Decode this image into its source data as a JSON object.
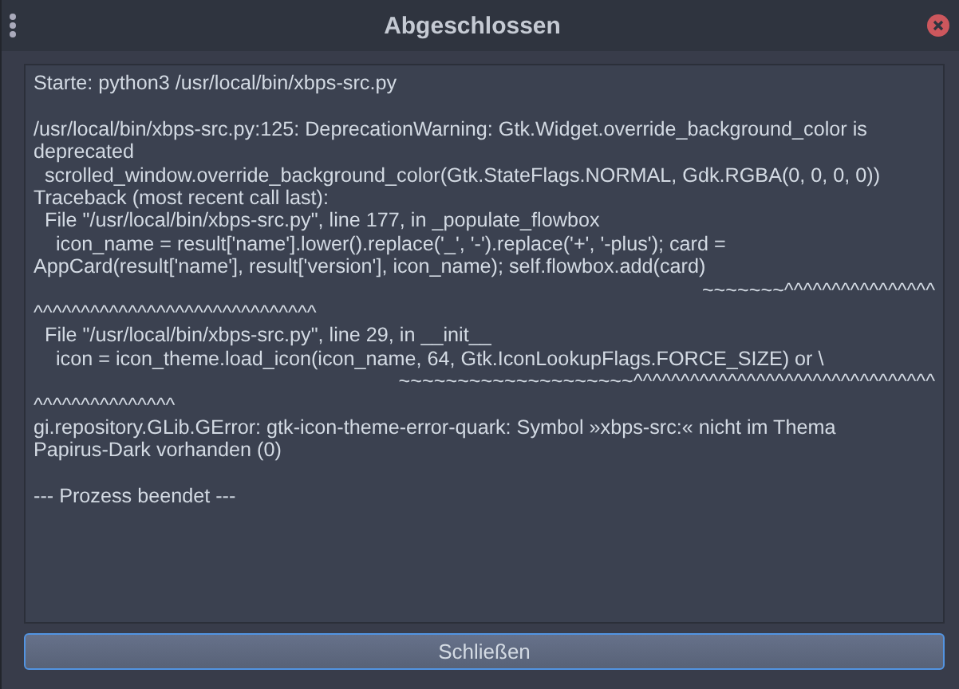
{
  "window": {
    "title": "Abgeschlossen"
  },
  "output": {
    "lines": [
      {
        "kind": "text",
        "text": "Starte: python3 /usr/local/bin/xbps-src.py"
      },
      {
        "kind": "blank"
      },
      {
        "kind": "text",
        "text": "/usr/local/bin/xbps-src.py:125: DeprecationWarning: Gtk.Widget.override_background_color is"
      },
      {
        "kind": "text",
        "text": "deprecated"
      },
      {
        "kind": "text",
        "text": "  scrolled_window.override_background_color(Gtk.StateFlags.NORMAL, Gdk.RGBA(0, 0, 0, 0))"
      },
      {
        "kind": "text",
        "text": "Traceback (most recent call last):"
      },
      {
        "kind": "text",
        "text": "  File \"/usr/local/bin/xbps-src.py\", line 177, in _populate_flowbox"
      },
      {
        "kind": "text",
        "text": "    icon_name = result['name'].lower().replace('_', '-').replace('+', '-plus'); card ="
      },
      {
        "kind": "text",
        "text": "AppCard(result['name'], result['version'], icon_name); self.flowbox.add(card)"
      },
      {
        "kind": "marker",
        "text": "~~~~~~~^^^^^^^^^^^^^^^^"
      },
      {
        "kind": "text",
        "text": "^^^^^^^^^^^^^^^^^^^^^^^^^^^^^^"
      },
      {
        "kind": "text",
        "text": "  File \"/usr/local/bin/xbps-src.py\", line 29, in __init__"
      },
      {
        "kind": "text",
        "text": "    icon = icon_theme.load_icon(icon_name, 64, Gtk.IconLookupFlags.FORCE_SIZE) or \\"
      },
      {
        "kind": "marker",
        "text": "~~~~~~~~~~~~~~~~~~~~^^^^^^^^^^^^^^^^^^^^^^^^^^^^^^^^"
      },
      {
        "kind": "text",
        "text": "^^^^^^^^^^^^^^^"
      },
      {
        "kind": "text",
        "text": "gi.repository.GLib.GError: gtk-icon-theme-error-quark: Symbol »xbps-src:« nicht im Thema"
      },
      {
        "kind": "text",
        "text": "Papirus-Dark vorhanden (0)"
      },
      {
        "kind": "blank"
      },
      {
        "kind": "text",
        "text": "--- Prozess beendet ---"
      }
    ]
  },
  "buttons": [
    {
      "label": "Schließen"
    }
  ]
}
